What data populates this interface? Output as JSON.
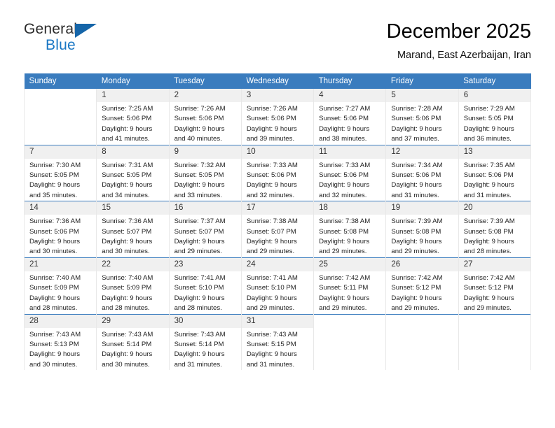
{
  "logo": {
    "word1": "General",
    "word2": "Blue",
    "triangle_color": "#1565a8",
    "blue_color": "#1a77c4"
  },
  "header": {
    "title": "December 2025",
    "subtitle": "Marand, East Azerbaijan, Iran"
  },
  "theme": {
    "header_bg": "#3a7cbe",
    "daynum_bg": "#f0f0f0",
    "grid_line": "#e8e8e8"
  },
  "calendar": {
    "weekday_headers": [
      "Sunday",
      "Monday",
      "Tuesday",
      "Wednesday",
      "Thursday",
      "Friday",
      "Saturday"
    ],
    "weeks": [
      [
        {
          "day": "",
          "sunrise": "",
          "sunset": "",
          "daylight_line1": "",
          "daylight_line2": ""
        },
        {
          "day": "1",
          "sunrise": "Sunrise: 7:25 AM",
          "sunset": "Sunset: 5:06 PM",
          "daylight_line1": "Daylight: 9 hours",
          "daylight_line2": "and 41 minutes."
        },
        {
          "day": "2",
          "sunrise": "Sunrise: 7:26 AM",
          "sunset": "Sunset: 5:06 PM",
          "daylight_line1": "Daylight: 9 hours",
          "daylight_line2": "and 40 minutes."
        },
        {
          "day": "3",
          "sunrise": "Sunrise: 7:26 AM",
          "sunset": "Sunset: 5:06 PM",
          "daylight_line1": "Daylight: 9 hours",
          "daylight_line2": "and 39 minutes."
        },
        {
          "day": "4",
          "sunrise": "Sunrise: 7:27 AM",
          "sunset": "Sunset: 5:06 PM",
          "daylight_line1": "Daylight: 9 hours",
          "daylight_line2": "and 38 minutes."
        },
        {
          "day": "5",
          "sunrise": "Sunrise: 7:28 AM",
          "sunset": "Sunset: 5:06 PM",
          "daylight_line1": "Daylight: 9 hours",
          "daylight_line2": "and 37 minutes."
        },
        {
          "day": "6",
          "sunrise": "Sunrise: 7:29 AM",
          "sunset": "Sunset: 5:05 PM",
          "daylight_line1": "Daylight: 9 hours",
          "daylight_line2": "and 36 minutes."
        }
      ],
      [
        {
          "day": "7",
          "sunrise": "Sunrise: 7:30 AM",
          "sunset": "Sunset: 5:05 PM",
          "daylight_line1": "Daylight: 9 hours",
          "daylight_line2": "and 35 minutes."
        },
        {
          "day": "8",
          "sunrise": "Sunrise: 7:31 AM",
          "sunset": "Sunset: 5:05 PM",
          "daylight_line1": "Daylight: 9 hours",
          "daylight_line2": "and 34 minutes."
        },
        {
          "day": "9",
          "sunrise": "Sunrise: 7:32 AM",
          "sunset": "Sunset: 5:05 PM",
          "daylight_line1": "Daylight: 9 hours",
          "daylight_line2": "and 33 minutes."
        },
        {
          "day": "10",
          "sunrise": "Sunrise: 7:33 AM",
          "sunset": "Sunset: 5:06 PM",
          "daylight_line1": "Daylight: 9 hours",
          "daylight_line2": "and 32 minutes."
        },
        {
          "day": "11",
          "sunrise": "Sunrise: 7:33 AM",
          "sunset": "Sunset: 5:06 PM",
          "daylight_line1": "Daylight: 9 hours",
          "daylight_line2": "and 32 minutes."
        },
        {
          "day": "12",
          "sunrise": "Sunrise: 7:34 AM",
          "sunset": "Sunset: 5:06 PM",
          "daylight_line1": "Daylight: 9 hours",
          "daylight_line2": "and 31 minutes."
        },
        {
          "day": "13",
          "sunrise": "Sunrise: 7:35 AM",
          "sunset": "Sunset: 5:06 PM",
          "daylight_line1": "Daylight: 9 hours",
          "daylight_line2": "and 31 minutes."
        }
      ],
      [
        {
          "day": "14",
          "sunrise": "Sunrise: 7:36 AM",
          "sunset": "Sunset: 5:06 PM",
          "daylight_line1": "Daylight: 9 hours",
          "daylight_line2": "and 30 minutes."
        },
        {
          "day": "15",
          "sunrise": "Sunrise: 7:36 AM",
          "sunset": "Sunset: 5:07 PM",
          "daylight_line1": "Daylight: 9 hours",
          "daylight_line2": "and 30 minutes."
        },
        {
          "day": "16",
          "sunrise": "Sunrise: 7:37 AM",
          "sunset": "Sunset: 5:07 PM",
          "daylight_line1": "Daylight: 9 hours",
          "daylight_line2": "and 29 minutes."
        },
        {
          "day": "17",
          "sunrise": "Sunrise: 7:38 AM",
          "sunset": "Sunset: 5:07 PM",
          "daylight_line1": "Daylight: 9 hours",
          "daylight_line2": "and 29 minutes."
        },
        {
          "day": "18",
          "sunrise": "Sunrise: 7:38 AM",
          "sunset": "Sunset: 5:08 PM",
          "daylight_line1": "Daylight: 9 hours",
          "daylight_line2": "and 29 minutes."
        },
        {
          "day": "19",
          "sunrise": "Sunrise: 7:39 AM",
          "sunset": "Sunset: 5:08 PM",
          "daylight_line1": "Daylight: 9 hours",
          "daylight_line2": "and 29 minutes."
        },
        {
          "day": "20",
          "sunrise": "Sunrise: 7:39 AM",
          "sunset": "Sunset: 5:08 PM",
          "daylight_line1": "Daylight: 9 hours",
          "daylight_line2": "and 28 minutes."
        }
      ],
      [
        {
          "day": "21",
          "sunrise": "Sunrise: 7:40 AM",
          "sunset": "Sunset: 5:09 PM",
          "daylight_line1": "Daylight: 9 hours",
          "daylight_line2": "and 28 minutes."
        },
        {
          "day": "22",
          "sunrise": "Sunrise: 7:40 AM",
          "sunset": "Sunset: 5:09 PM",
          "daylight_line1": "Daylight: 9 hours",
          "daylight_line2": "and 28 minutes."
        },
        {
          "day": "23",
          "sunrise": "Sunrise: 7:41 AM",
          "sunset": "Sunset: 5:10 PM",
          "daylight_line1": "Daylight: 9 hours",
          "daylight_line2": "and 28 minutes."
        },
        {
          "day": "24",
          "sunrise": "Sunrise: 7:41 AM",
          "sunset": "Sunset: 5:10 PM",
          "daylight_line1": "Daylight: 9 hours",
          "daylight_line2": "and 29 minutes."
        },
        {
          "day": "25",
          "sunrise": "Sunrise: 7:42 AM",
          "sunset": "Sunset: 5:11 PM",
          "daylight_line1": "Daylight: 9 hours",
          "daylight_line2": "and 29 minutes."
        },
        {
          "day": "26",
          "sunrise": "Sunrise: 7:42 AM",
          "sunset": "Sunset: 5:12 PM",
          "daylight_line1": "Daylight: 9 hours",
          "daylight_line2": "and 29 minutes."
        },
        {
          "day": "27",
          "sunrise": "Sunrise: 7:42 AM",
          "sunset": "Sunset: 5:12 PM",
          "daylight_line1": "Daylight: 9 hours",
          "daylight_line2": "and 29 minutes."
        }
      ],
      [
        {
          "day": "28",
          "sunrise": "Sunrise: 7:43 AM",
          "sunset": "Sunset: 5:13 PM",
          "daylight_line1": "Daylight: 9 hours",
          "daylight_line2": "and 30 minutes."
        },
        {
          "day": "29",
          "sunrise": "Sunrise: 7:43 AM",
          "sunset": "Sunset: 5:14 PM",
          "daylight_line1": "Daylight: 9 hours",
          "daylight_line2": "and 30 minutes."
        },
        {
          "day": "30",
          "sunrise": "Sunrise: 7:43 AM",
          "sunset": "Sunset: 5:14 PM",
          "daylight_line1": "Daylight: 9 hours",
          "daylight_line2": "and 31 minutes."
        },
        {
          "day": "31",
          "sunrise": "Sunrise: 7:43 AM",
          "sunset": "Sunset: 5:15 PM",
          "daylight_line1": "Daylight: 9 hours",
          "daylight_line2": "and 31 minutes."
        },
        {
          "day": "",
          "sunrise": "",
          "sunset": "",
          "daylight_line1": "",
          "daylight_line2": ""
        },
        {
          "day": "",
          "sunrise": "",
          "sunset": "",
          "daylight_line1": "",
          "daylight_line2": ""
        },
        {
          "day": "",
          "sunrise": "",
          "sunset": "",
          "daylight_line1": "",
          "daylight_line2": ""
        }
      ]
    ]
  }
}
